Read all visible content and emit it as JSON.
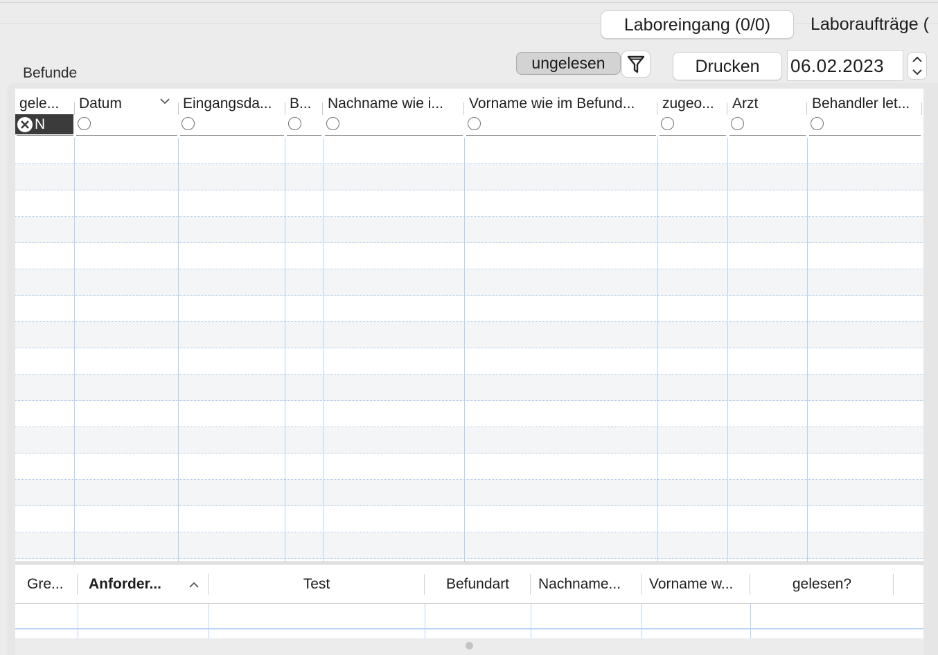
{
  "tabs": [
    {
      "label": "Laboreingang (0/0)",
      "active": true
    },
    {
      "label": "Laboraufträge (",
      "active": false
    }
  ],
  "section_label": "Befunde",
  "toolbar": {
    "filter_toggle_label": "ungelesen",
    "filter_icon": "funnel-icon",
    "print_label": "Drucken",
    "date_value": "06.02.2023"
  },
  "top_table": {
    "columns": [
      {
        "label": "gele..."
      },
      {
        "label": "Datum"
      },
      {
        "label": "Eingangsda..."
      },
      {
        "label": "B..."
      },
      {
        "label": "Nachname wie i..."
      },
      {
        "label": "Vorname wie im Befund..."
      },
      {
        "label": "zugeo..."
      },
      {
        "label": "Arzt"
      },
      {
        "label": "Behandler let..."
      }
    ],
    "first_filter_value": "N",
    "sort_column": "Datum",
    "sort_direction": "descending",
    "rows": []
  },
  "bottom_table": {
    "columns": [
      {
        "label": "Gre..."
      },
      {
        "label": "Anforder..."
      },
      {
        "label": "Test"
      },
      {
        "label": "Befundart"
      },
      {
        "label": "Nachname..."
      },
      {
        "label": "Vorname w..."
      },
      {
        "label": "gelesen?"
      }
    ],
    "sort_column": "Anforder...",
    "sort_direction": "ascending",
    "rows": []
  },
  "colors": {
    "window_bg": "#ececec",
    "grid_line": "#b5d3f2",
    "selected_cell": "#3b3b3b"
  }
}
